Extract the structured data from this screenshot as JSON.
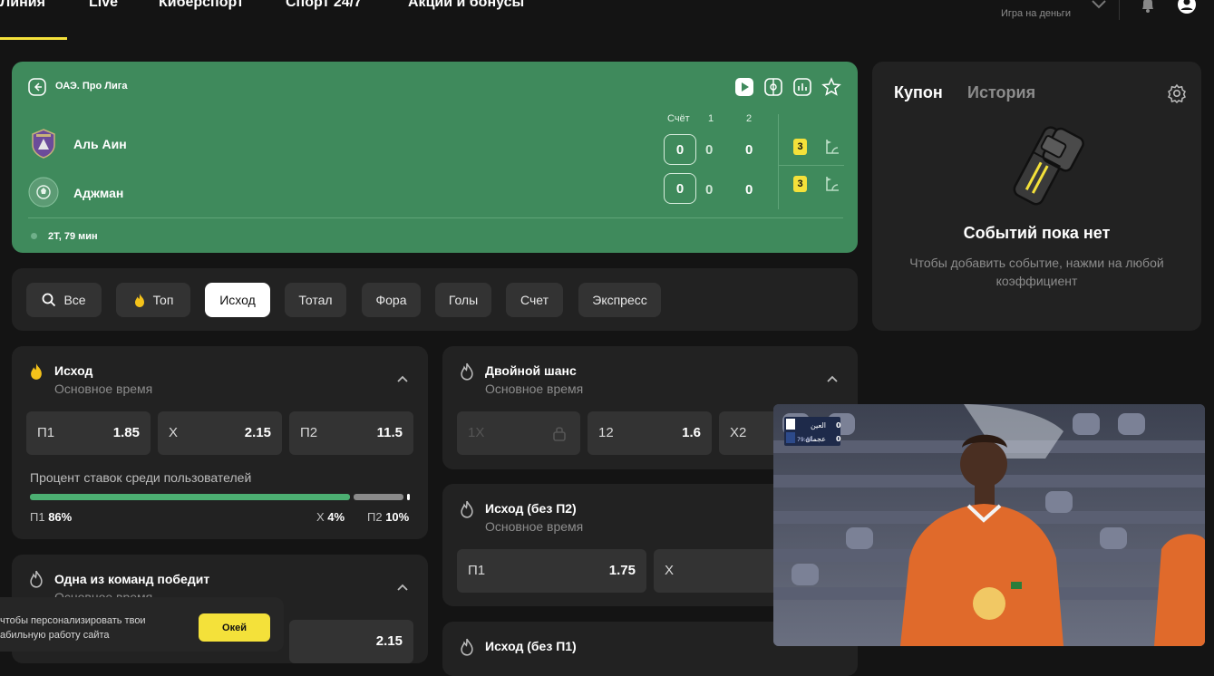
{
  "nav": {
    "items": [
      "Линия",
      "Live",
      "Киберспорт",
      "Спорт 24/7",
      "Акции и бонусы"
    ],
    "money_label": "Игра на деньги"
  },
  "match": {
    "league": "ОАЭ. Про Лига",
    "score_head": [
      "Счёт",
      "1",
      "2"
    ],
    "teams": [
      {
        "name": "Аль Аин",
        "score": "0",
        "p1": "0",
        "p2": "0",
        "corners": "3"
      },
      {
        "name": "Аджман",
        "score": "0",
        "p1": "0",
        "p2": "0",
        "corners": "3"
      }
    ],
    "time": "2Т, 79 мин",
    "accent": "#3f8a5c"
  },
  "filters": [
    "Все",
    "Топ",
    "Исход",
    "Тотал",
    "Фора",
    "Голы",
    "Счет",
    "Экспресс"
  ],
  "active_filter": "Исход",
  "markets": {
    "outcome": {
      "title": "Исход",
      "sub": "Основное время",
      "odds": [
        {
          "label": "П1",
          "value": "1.85"
        },
        {
          "label": "Х",
          "value": "2.15"
        },
        {
          "label": "П2",
          "value": "11.5"
        }
      ],
      "pct_title": "Процент ставок среди пользователей",
      "pct": [
        {
          "label": "П1",
          "value": "86%",
          "share": 86,
          "color": "#4caf72"
        },
        {
          "label": "Х",
          "value": "4%",
          "share": 4,
          "color": "#8a8a8a"
        },
        {
          "label": "П2",
          "value": "10%",
          "share": 10,
          "color": "#ffffff"
        }
      ]
    },
    "double": {
      "title": "Двойной шанс",
      "sub": "Основное время",
      "odds": [
        {
          "label": "1Х",
          "value": ""
        },
        {
          "label": "12",
          "value": "1.6"
        },
        {
          "label": "Х2",
          "value": ""
        }
      ]
    },
    "no_p2": {
      "title": "Исход (без П2)",
      "sub": "Основное время",
      "odds": [
        {
          "label": "П1",
          "value": "1.75"
        },
        {
          "label": "Х",
          "value": ""
        }
      ]
    },
    "one_wins": {
      "title": "Одна из команд победит",
      "sub": "Основное время",
      "odd_value": "2.15"
    },
    "no_p1": {
      "title": "Исход (без П1)"
    }
  },
  "coupon": {
    "tab_active": "Купон",
    "tab_other": "История",
    "empty_title": "Событий пока нет",
    "empty_hint": "Чтобы добавить событие, нажми на любой коэффициент"
  },
  "cookie": {
    "text_line1": "чтобы персонализировать твои",
    "text_line2": "абильную работу сайта",
    "ok": "Окей"
  },
  "video": {
    "team1": "العين",
    "team2": "عجمان",
    "s1": "0",
    "s2": "0",
    "clock": "79:43"
  }
}
